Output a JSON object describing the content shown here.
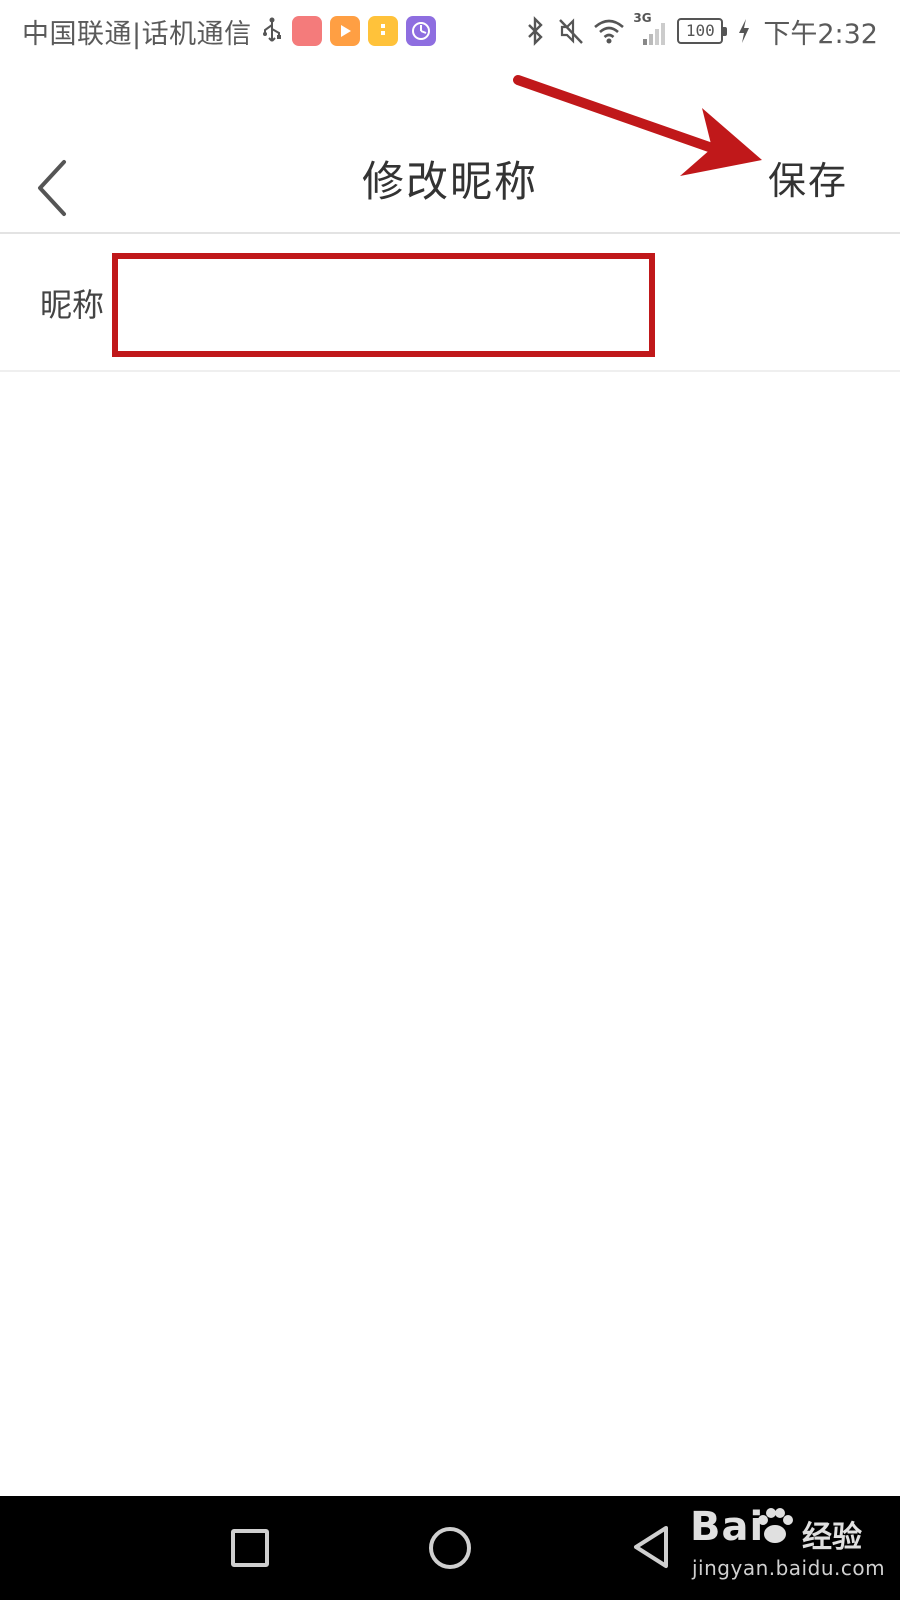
{
  "status_bar": {
    "carrier": "中国联通|话机通信",
    "battery": "100",
    "network": "3G",
    "time": "下午2:32",
    "app_icons": [
      "huawei-store-icon",
      "video-app-icon",
      "files-app-icon",
      "clock-app-icon"
    ]
  },
  "header": {
    "back_icon": "chevron-left-icon",
    "title": "修改昵称",
    "save_label": "保存"
  },
  "form": {
    "nickname_label": "昵称",
    "nickname_value": "",
    "nickname_placeholder": ""
  },
  "annotations": {
    "highlight_color": "#c0181a",
    "arrow_color": "#c0181a",
    "highlight_target": "nickname-input",
    "arrow_target": "save-button"
  },
  "nav_bar": {
    "buttons": [
      "recent-apps-icon",
      "home-icon",
      "back-triangle-icon"
    ]
  },
  "watermark": {
    "logo_text": "Bai",
    "brand": "经验",
    "url": "jingyan.baidu.com"
  },
  "colors": {
    "background": "#ffffff",
    "text": "#333333",
    "divider": "#e3e3e3",
    "nav_bar": "#000000"
  }
}
